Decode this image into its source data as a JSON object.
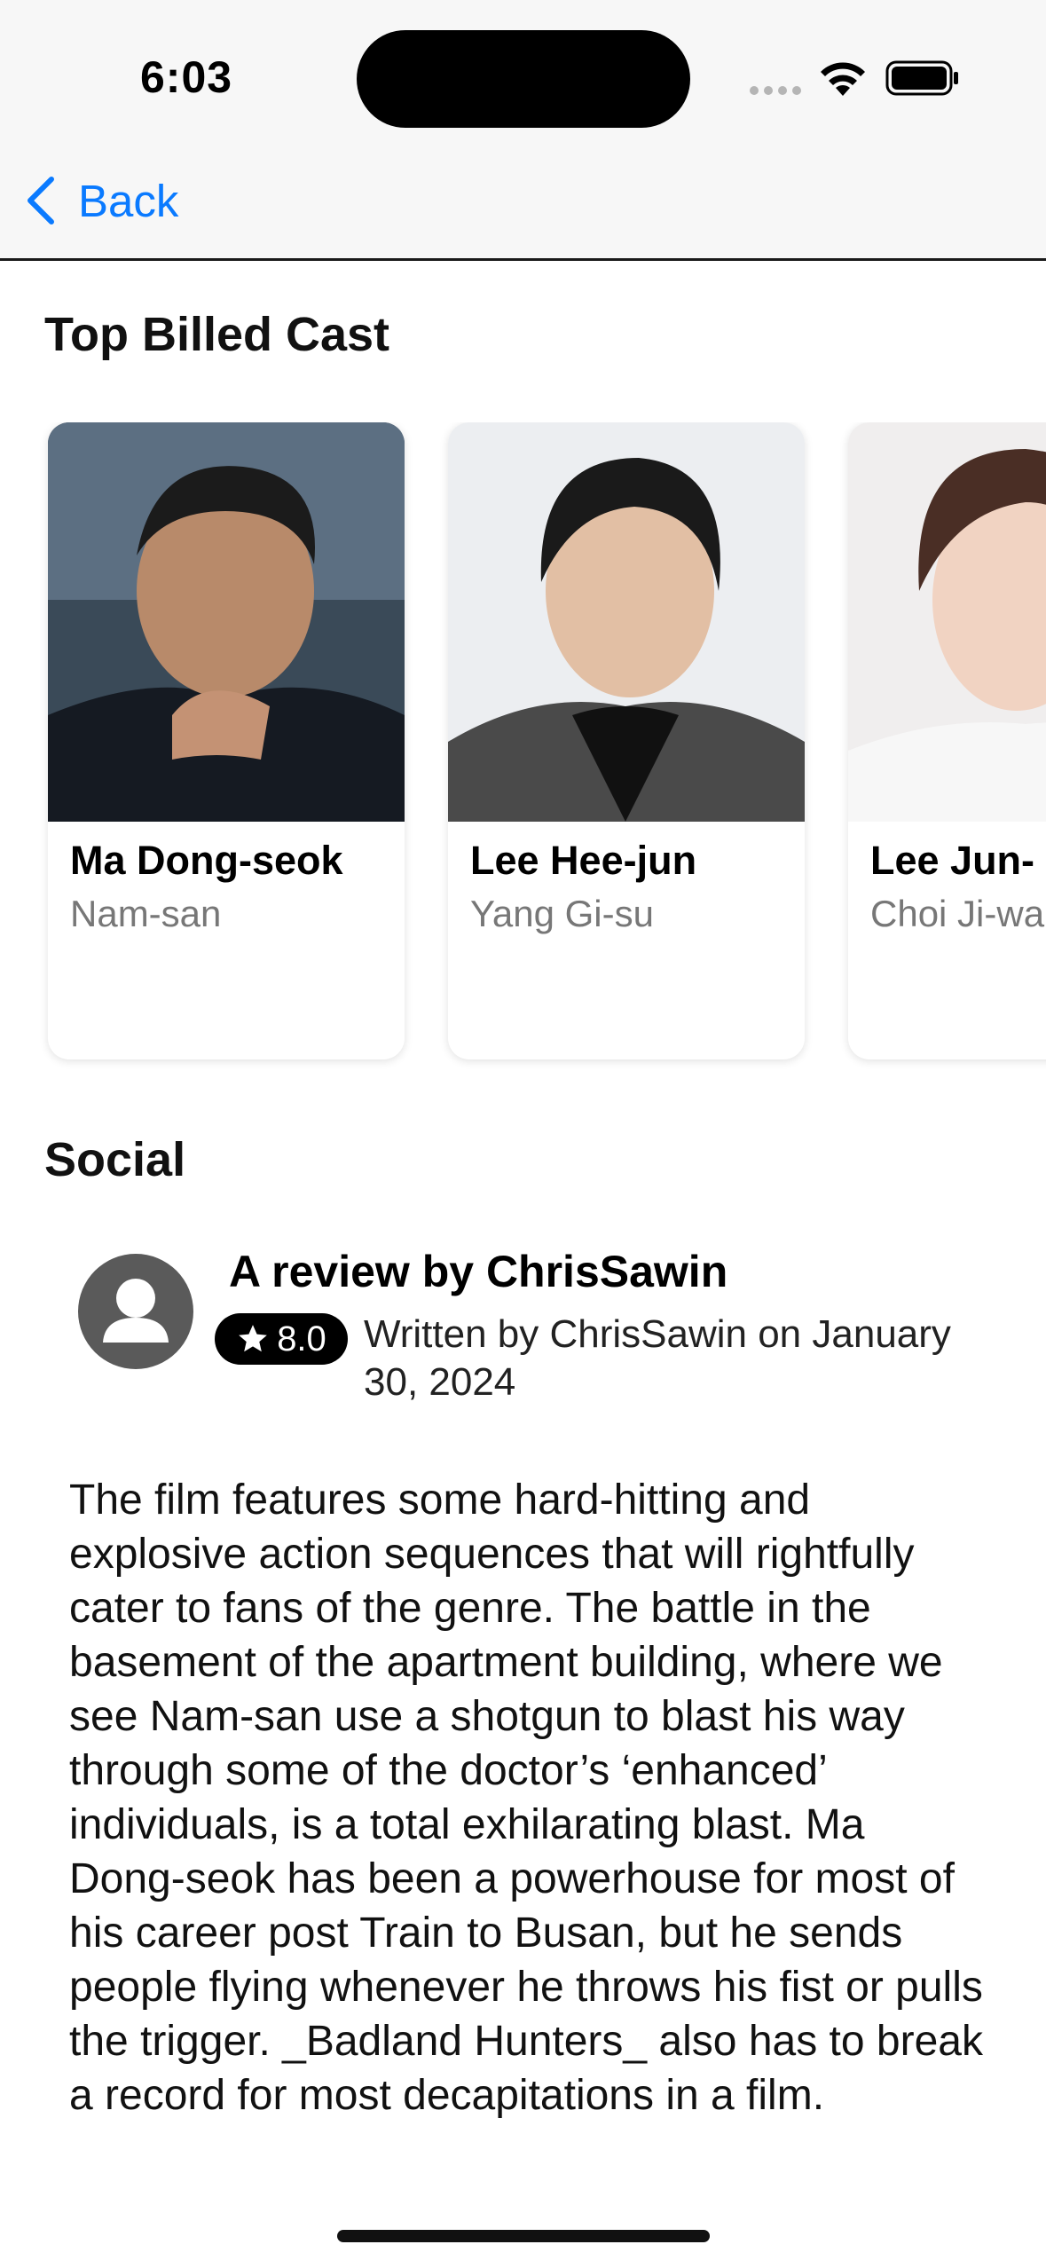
{
  "status_bar": {
    "time": "6:03"
  },
  "nav": {
    "back_label": "Back"
  },
  "cast_section": {
    "title": "Top Billed Cast",
    "cast": [
      {
        "name": "Ma Dong-seok",
        "role": "Nam-san"
      },
      {
        "name": "Lee Hee-jun",
        "role": "Yang Gi-su"
      },
      {
        "name": "Lee Jun-",
        "role": "Choi Ji-wa"
      }
    ]
  },
  "social_section": {
    "title": "Social",
    "review": {
      "title": "A review by ChrisSawin",
      "rating": "8.0",
      "written_line": "Written by ChrisSawin on January 30, 2024",
      "body": "The film features some hard-hitting and explosive action sequences that will rightfully cater to fans of the genre. The battle in the basement of the apartment building, where we see Nam-san use a shotgun to blast his way through some of the doctor’s ‘enhanced’ individuals, is a total exhilarating blast. Ma Dong-seok has been a powerhouse for most of his career post Train to Busan, but he sends people flying whenever he throws his fist or pulls the trigger. _Badland Hunters_ also has to break a record for most decapitations in a film."
    }
  },
  "colors": {
    "accent": "#0a7aff",
    "secondary_text": "#777777"
  }
}
